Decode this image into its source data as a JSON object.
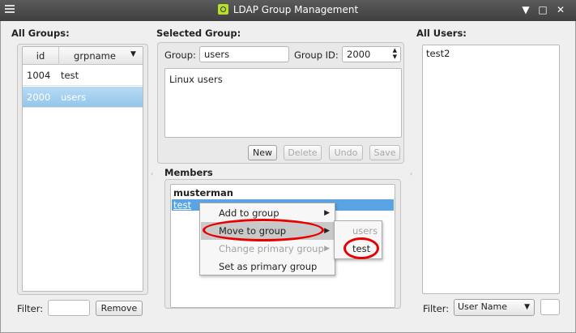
{
  "window": {
    "title": "LDAP Group Management"
  },
  "all_groups": {
    "label": "All Groups:",
    "columns": [
      "id",
      "grpname"
    ],
    "rows": [
      {
        "id": "1004",
        "name": "test"
      },
      {
        "id": "2000",
        "name": "users"
      }
    ],
    "filter_label": "Filter:",
    "filter_value": "",
    "remove_label": "Remove"
  },
  "selected_group": {
    "label": "Selected Group:",
    "group_label": "Group:",
    "group_value": "users",
    "group_id_label": "Group ID:",
    "group_id_value": "2000",
    "description": "Linux users",
    "buttons": {
      "new": "New",
      "delete": "Delete",
      "undo": "Undo",
      "save": "Save"
    }
  },
  "members": {
    "label": "Members",
    "items": [
      "musterman",
      "test"
    ]
  },
  "context_menu": {
    "items": [
      "Add to group",
      "Move to group",
      "Change primary group",
      "Set as primary group"
    ],
    "submenu": [
      "users",
      "test"
    ]
  },
  "all_users": {
    "label": "All Users:",
    "items": [
      "test2"
    ],
    "filter_label": "Filter:",
    "filter_field": "User Name",
    "filter_value": ""
  },
  "colors": {
    "highlight": "#e60000",
    "selection": "#94c6ea"
  }
}
